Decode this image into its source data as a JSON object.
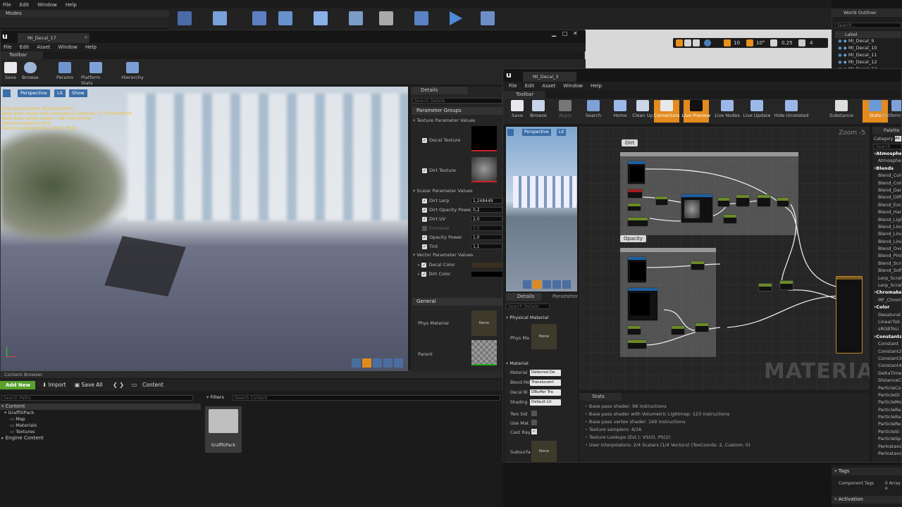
{
  "main_menu": [
    "File",
    "Edit",
    "Window",
    "Help"
  ],
  "modes_tab": "Modes",
  "world_outliner": {
    "title": "World Outliner",
    "search_placeholder": "Search...",
    "column": "Label",
    "items": [
      "MI_Decal_9",
      "MI_Decal_10",
      "MI_Decal_11",
      "MI_Decal_12",
      "MI_Decal_13"
    ]
  },
  "viewport_toolbar": {
    "snap_grid": "10",
    "snap_rot": "10°",
    "snap_scale": "0,25",
    "cam_speed": "4"
  },
  "editor1": {
    "tab": "MI_Decal_17",
    "menu": [
      "File",
      "Edit",
      "Asset",
      "Window",
      "Help"
    ],
    "toolbar_tab": "Toolbar",
    "tools": [
      "Save",
      "Browse",
      "Params",
      "Platform Stats",
      "Hierarchy"
    ],
    "viewport": {
      "buttons": [
        "Perspective",
        "Lit",
        "Show"
      ],
      "stats": [
        "Base pass shader: 96 instructions",
        "Base pass shader with Volumetric Lightmap: 123 instructions",
        "Base pass vertex shader: 169 instructions",
        "Texture samplers: 4/16",
        "Texture Lookups (Est.): VS(0), PS(2)"
      ]
    },
    "details": {
      "tab": "Details",
      "search_placeholder": "Search Details",
      "param_groups": "Parameter Groups",
      "texture_params": "Texture Parameter Values",
      "decal_texture": "Decal Texture",
      "dirt_texture": "Dirt Texture",
      "scalar_params": "Scalar Parameter Values",
      "scalars": [
        {
          "label": "Dirt Lerp",
          "value": "1,248449",
          "enabled": true
        },
        {
          "label": "Dirt Opacity Power",
          "value": "0,2",
          "enabled": true
        },
        {
          "label": "Dirt UV",
          "value": "2,0",
          "enabled": true
        },
        {
          "label": "Emissive",
          "value": "0,0",
          "enabled": false
        },
        {
          "label": "Opacity Power",
          "value": "1,0",
          "enabled": true
        },
        {
          "label": "Tint",
          "value": "1,1",
          "enabled": true
        }
      ],
      "vector_params": "Vector Parameter Values",
      "decal_color": "Decal Color",
      "dirt_color": "Dirt Color",
      "general": "General",
      "phys_material": "Phys Material",
      "phys_none": "None",
      "parent": "Parent"
    }
  },
  "content_browser": {
    "tab": "Content Browser",
    "add_new": "Add New",
    "import": "Import",
    "save_all": "Save All",
    "path": "Content",
    "search_paths": "Search Paths",
    "filters": "Filters",
    "search_content": "Search Content",
    "tree": [
      "Content",
      "GraffitiPack",
      "Map",
      "Materials",
      "Textures",
      "Engine Content"
    ],
    "asset": "GraffitiPack"
  },
  "editor2": {
    "tab": "MI_Decal_3",
    "menu": [
      "File",
      "Edit",
      "Asset",
      "Window",
      "Help"
    ],
    "toolbar_tab": "Toolbar",
    "tools": [
      "Save",
      "Browse",
      "Apply",
      "Search",
      "Home",
      "Clean Up",
      "Connectors",
      "Live Preview",
      "Live Nodes",
      "Live Update",
      "Hide Unrelated",
      "Substance",
      "Stats",
      "Platform Stats"
    ],
    "preview_buttons": [
      "Perspective",
      "Lit"
    ],
    "graph": {
      "zoom": "Zoom -5",
      "comment_dirt": "Dirt",
      "comment_opacity": "Opacity",
      "watermark": "MATERIAL"
    },
    "details": {
      "tabs": [
        "Details",
        "Parameters"
      ],
      "search_placeholder": "Search Details",
      "physical_material": "Physical Material",
      "phys_mat_label": "Phys Ma",
      "none": "None",
      "material_section": "Material",
      "rows": [
        {
          "label": "Material",
          "value": "Deferred De"
        },
        {
          "label": "Blend Mo",
          "value": "Translucent"
        },
        {
          "label": "Decal Bl",
          "value": "DBuffer Tra"
        },
        {
          "label": "Shading",
          "value": "Default Lit"
        }
      ],
      "two_sided": "Two Sid",
      "use_mat": "Use Mat",
      "cast_ray": "Cast Ray",
      "subsurface": "Subsurfa",
      "subsurface_none": "None"
    },
    "stats": {
      "tab": "Stats",
      "lines": [
        "Base pass shader: 96 instructions",
        "Base pass shader with Volumetric Lightmap: 123 instructions",
        "Base pass vertex shader: 169 instructions",
        "Texture samplers: 4/16",
        "Texture Lookups (Est.): VS(0), PS(2)",
        "User interpolators: 2/4 Scalars (1/4 Vectors) (TexCoords: 2, Custom: 0)"
      ]
    },
    "palette": {
      "tab": "Palette",
      "category_label": "Category",
      "category_value": "All",
      "search_placeholder": "Search",
      "entries": [
        {
          "t": "cat",
          "v": "Atmosphere"
        },
        {
          "t": "item",
          "v": "Atmosphe"
        },
        {
          "t": "cat",
          "v": "Blends"
        },
        {
          "t": "item",
          "v": "Blend_Colo"
        },
        {
          "t": "item",
          "v": "Blend_Colo"
        },
        {
          "t": "item",
          "v": "Blend_Dark"
        },
        {
          "t": "item",
          "v": "Blend_Diffe"
        },
        {
          "t": "item",
          "v": "Blend_Excl"
        },
        {
          "t": "item",
          "v": "Blend_Hard"
        },
        {
          "t": "item",
          "v": "Blend_Light"
        },
        {
          "t": "item",
          "v": "Blend_Linea"
        },
        {
          "t": "item",
          "v": "Blend_Linea"
        },
        {
          "t": "item",
          "v": "Blend_Linea"
        },
        {
          "t": "item",
          "v": "Blend_Over"
        },
        {
          "t": "item",
          "v": "Blend_PinL"
        },
        {
          "t": "item",
          "v": "Blend_Scre"
        },
        {
          "t": "item",
          "v": "Blend_Soft"
        },
        {
          "t": "item",
          "v": "Lerp_Scrat"
        },
        {
          "t": "item",
          "v": "Lerp_Scrat"
        },
        {
          "t": "cat",
          "v": "Chromakeying"
        },
        {
          "t": "item",
          "v": "MF_Chrom"
        },
        {
          "t": "cat",
          "v": "Color"
        },
        {
          "t": "item",
          "v": "Desaturat"
        },
        {
          "t": "item",
          "v": "LinearToS"
        },
        {
          "t": "item",
          "v": "sRGBToLi"
        },
        {
          "t": "cat",
          "v": "Constants"
        },
        {
          "t": "item",
          "v": "Constant"
        },
        {
          "t": "item",
          "v": "Constant2"
        },
        {
          "t": "item",
          "v": "Constant3"
        },
        {
          "t": "item",
          "v": "Constant4"
        },
        {
          "t": "item",
          "v": "DeltaTime"
        },
        {
          "t": "item",
          "v": "DistanceC"
        },
        {
          "t": "item",
          "v": "ParticleCo"
        },
        {
          "t": "item",
          "v": "ParticleDi"
        },
        {
          "t": "item",
          "v": "ParticleMo"
        },
        {
          "t": "item",
          "v": "ParticleRa"
        },
        {
          "t": "item",
          "v": "ParticleRa"
        },
        {
          "t": "item",
          "v": "ParticleRe"
        },
        {
          "t": "item",
          "v": "ParticleSi"
        },
        {
          "t": "item",
          "v": "ParticleSp"
        },
        {
          "t": "item",
          "v": "PerInstanc"
        },
        {
          "t": "item",
          "v": "PerInstanc"
        }
      ]
    }
  },
  "tags_panel": {
    "title": "Tags",
    "component_tags": "Component Tags",
    "value": "0 Array e",
    "activation": "Activation"
  }
}
